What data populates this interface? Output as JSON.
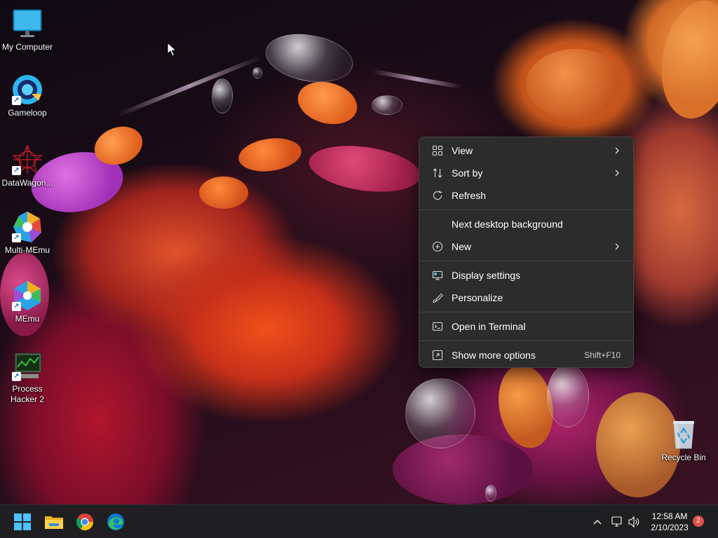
{
  "desktop": {
    "icons": [
      {
        "label": "My Computer",
        "icon": "monitor-icon",
        "shortcut": false
      },
      {
        "label": "Gameloop",
        "icon": "gameloop-icon",
        "shortcut": true
      },
      {
        "label": "DataWagon...",
        "icon": "datawagon-icon",
        "shortcut": true
      },
      {
        "label": "Multi-MEmu",
        "icon": "multi-memu-icon",
        "shortcut": true
      },
      {
        "label": "MEmu",
        "icon": "memu-icon",
        "shortcut": true
      },
      {
        "label": "Process Hacker 2",
        "icon": "process-hacker-icon",
        "shortcut": true
      },
      {
        "label": "Recycle Bin",
        "icon": "recycle-bin-icon",
        "shortcut": false
      }
    ]
  },
  "context_menu": {
    "items": [
      {
        "label": "View",
        "icon": "grid-view-icon",
        "submenu": true
      },
      {
        "label": "Sort by",
        "icon": "sort-icon",
        "submenu": true
      },
      {
        "label": "Refresh",
        "icon": "refresh-icon",
        "submenu": false
      },
      {
        "label": "Next desktop background",
        "icon": "",
        "submenu": false
      },
      {
        "label": "New",
        "icon": "plus-circle-icon",
        "submenu": true
      },
      {
        "label": "Display settings",
        "icon": "display-settings-icon",
        "submenu": false
      },
      {
        "label": "Personalize",
        "icon": "brush-icon",
        "submenu": false
      },
      {
        "label": "Open in Terminal",
        "icon": "terminal-icon",
        "submenu": false
      },
      {
        "label": "Show more options",
        "icon": "more-options-icon",
        "submenu": false,
        "shortcut": "Shift+F10"
      }
    ]
  },
  "taskbar": {
    "apps": [
      {
        "name": "Start",
        "icon": "windows-start-icon"
      },
      {
        "name": "File Explorer",
        "icon": "file-explorer-icon"
      },
      {
        "name": "Google Chrome",
        "icon": "chrome-icon"
      },
      {
        "name": "Microsoft Edge",
        "icon": "edge-icon"
      }
    ],
    "tray": {
      "time": "12:58 AM",
      "date": "2/10/2023",
      "notification_count": "2"
    }
  },
  "colors": {
    "menu_bg": "#2c2c2c",
    "taskbar_bg": "#1f1f22",
    "accent_blue": "#4cc2ff",
    "badge_red": "#e0504a"
  }
}
